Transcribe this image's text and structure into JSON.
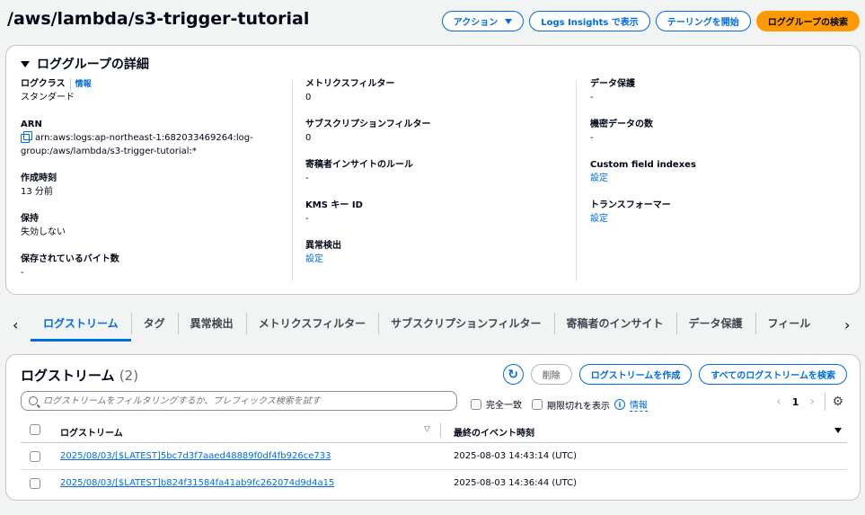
{
  "header": {
    "title": "/aws/lambda/s3-trigger-tutorial",
    "actions_label": "アクション",
    "logs_insights_label": "Logs Insights で表示",
    "tailing_label": "テーリングを開始",
    "search_group_label": "ロググループの検索"
  },
  "details": {
    "title": "ロググループの詳細",
    "log_class_label": "ログクラス",
    "log_class_info": "情報",
    "log_class_value": "スタンダード",
    "arn_label": "ARN",
    "arn_value": "arn:aws:logs:ap-northeast-1:682033469264:log-group:/aws/lambda/s3-trigger-tutorial:*",
    "created_label": "作成時刻",
    "created_value": "13 分前",
    "retention_label": "保持",
    "retention_value": "失効しない",
    "stored_bytes_label": "保存されているバイト数",
    "stored_bytes_value": "-",
    "metric_filters_label": "メトリクスフィルター",
    "metric_filters_value": "0",
    "subscription_filters_label": "サブスクリプションフィルター",
    "subscription_filters_value": "0",
    "contributor_rules_label": "寄稿者インサイトのルール",
    "contributor_rules_value": "-",
    "kms_label": "KMS キー ID",
    "kms_value": "-",
    "anomaly_label": "異常検出",
    "anomaly_value": "設定",
    "data_protection_label": "データ保護",
    "data_protection_value": "-",
    "sensitive_label": "機密データの数",
    "sensitive_value": "-",
    "custom_field_label": "Custom field indexes",
    "custom_field_value": "設定",
    "transformer_label": "トランスフォーマー",
    "transformer_value": "設定"
  },
  "tabs": [
    "ログストリーム",
    "タグ",
    "異常検出",
    "メトリクスフィルター",
    "サブスクリプションフィルター",
    "寄稿者のインサイト",
    "データ保護",
    "フィール"
  ],
  "streams": {
    "title": "ログストリーム",
    "count": "(2)",
    "delete_label": "削除",
    "create_label": "ログストリームを作成",
    "search_all_label": "すべてのログストリームを検索",
    "search_placeholder": "ログストリームをフィルタリングするか、プレフィックス検索を試す",
    "exact_match_label": "完全一致",
    "show_expired_label": "期限切れを表示",
    "info_label": "情報",
    "page": "1",
    "col_stream": "ログストリーム",
    "col_last_event": "最終のイベント時刻",
    "rows": [
      {
        "name": "2025/08/03/[$LATEST]5bc7d3f7aaed48889f0df4fb926ce733",
        "time": "2025-08-03 14:43:14 (UTC)"
      },
      {
        "name": "2025/08/03/[$LATEST]b824f31584fa41ab9fc262074d9d4a15",
        "time": "2025-08-03 14:36:44 (UTC)"
      }
    ]
  }
}
